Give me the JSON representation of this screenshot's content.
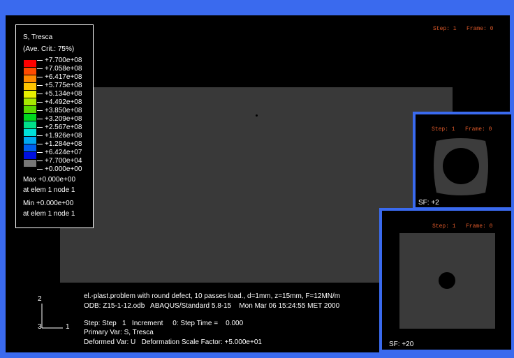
{
  "main": {
    "step_label": "Step: 1   Frame: 0"
  },
  "legend": {
    "title1": "S, Tresca",
    "title2": "(Ave. Crit.: 75%)",
    "levels": [
      {
        "value": "+7.700e+08",
        "color": "#ff0000"
      },
      {
        "value": "+7.058e+08",
        "color": "#ff4a00"
      },
      {
        "value": "+6.417e+08",
        "color": "#ff8a00"
      },
      {
        "value": "+5.775e+08",
        "color": "#ffc400"
      },
      {
        "value": "+5.134e+08",
        "color": "#e8f000"
      },
      {
        "value": "+4.492e+08",
        "color": "#a8e800"
      },
      {
        "value": "+3.850e+08",
        "color": "#5ad800"
      },
      {
        "value": "+3.209e+08",
        "color": "#00d820"
      },
      {
        "value": "+2.567e+08",
        "color": "#00e08a"
      },
      {
        "value": "+1.926e+08",
        "color": "#00e0d8"
      },
      {
        "value": "+1.284e+08",
        "color": "#00a8f0"
      },
      {
        "value": "+6.424e+07",
        "color": "#0060f0"
      },
      {
        "value": "+7.700e+04",
        "color": "#0010e0"
      },
      {
        "value": "+0.000e+00",
        "color": "#777777"
      }
    ],
    "max_line1": "Max +0.000e+00",
    "max_line2": "at elem 1 node 1",
    "min_line1": "Min +0.000e+00",
    "min_line2": "at elem 1 node 1"
  },
  "info": {
    "line1": "el.-plast.problem with round defect, 10 passes load., d=1mm, z=15mm, F=12MN/m",
    "line2": "ODB: Z15-1-12.odb   ABAQUS/Standard 5.8-15    Mon Mar 06 15:24:55 MET 2000",
    "line3": "Step: Step   1   Increment     0: Step Time =    0.000",
    "line4": "Primary Var: S, Tresca",
    "line5": "Deformed Var: U   Deformation Scale Factor: +5.000e+01"
  },
  "axes": {
    "y": "2",
    "z": "3",
    "x": "1"
  },
  "viewport2": {
    "step_label": "Step: 1   Frame: 0",
    "sf": "SF: +2"
  },
  "viewport3": {
    "step_label": "Step: 1   Frame: 0",
    "sf": "SF: +20"
  }
}
